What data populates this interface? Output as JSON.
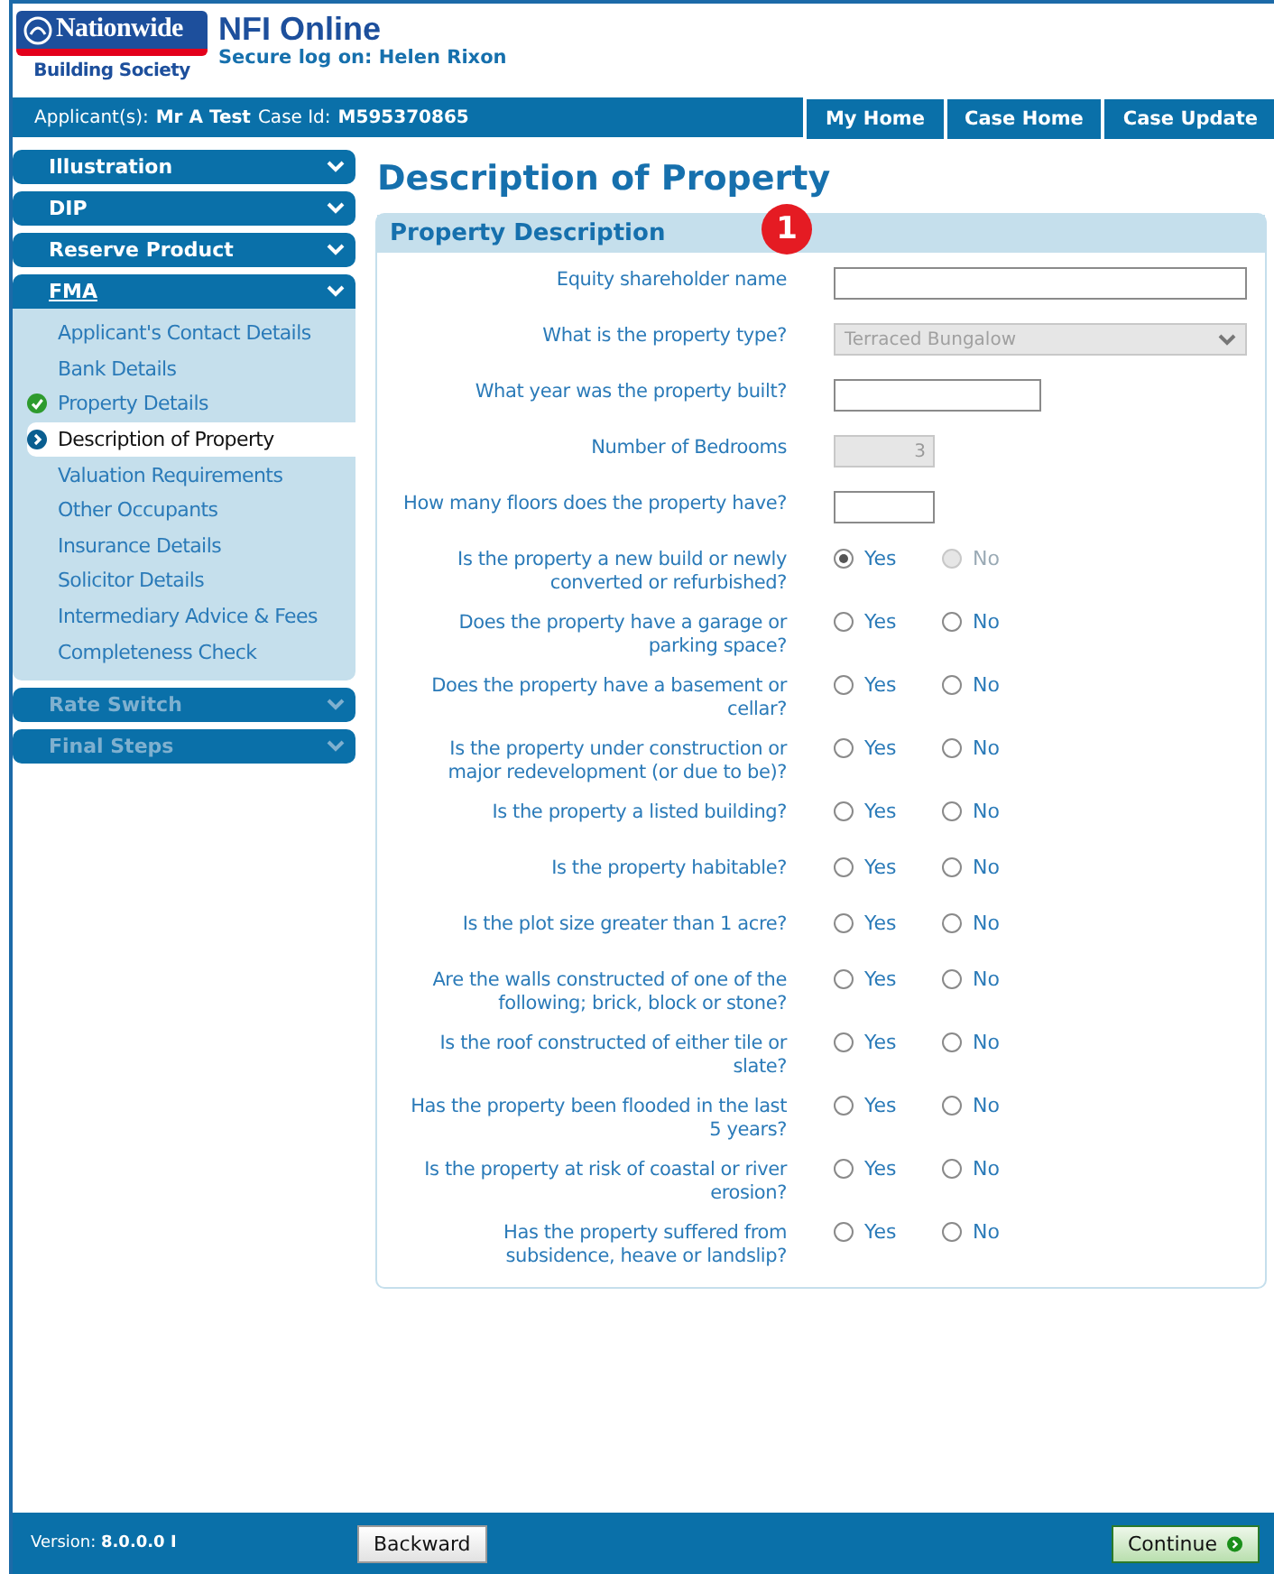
{
  "header": {
    "logo_name": "Nationwide",
    "logo_subtitle": "Building Society",
    "app_title": "NFI Online",
    "logon": "Secure log on: Helen Rixon"
  },
  "applicant_bar": {
    "applicant_label": "Applicant(s):",
    "applicant": "Mr A Test",
    "case_label": "Case Id:",
    "case_id": "M595370865"
  },
  "top_nav": [
    {
      "label": "My Home"
    },
    {
      "label": "Case Home"
    },
    {
      "label": "Case Update"
    }
  ],
  "sidebar": {
    "sections": [
      {
        "label": "Illustration",
        "selected": false,
        "disabled": false,
        "expanded": false
      },
      {
        "label": "DIP",
        "selected": false,
        "disabled": false,
        "expanded": false
      },
      {
        "label": "Reserve Product",
        "selected": false,
        "disabled": false,
        "expanded": false
      },
      {
        "label": "FMA",
        "selected": true,
        "disabled": false,
        "expanded": true,
        "children": [
          {
            "label": "Applicant's Contact Details",
            "selected": false,
            "completed": false
          },
          {
            "label": "Bank Details",
            "selected": false,
            "completed": false
          },
          {
            "label": "Property Details",
            "selected": false,
            "completed": true
          },
          {
            "label": "Description of Property",
            "selected": true,
            "completed": false
          },
          {
            "label": "Valuation Requirements",
            "selected": false,
            "completed": false
          },
          {
            "label": "Other Occupants",
            "selected": false,
            "completed": false
          },
          {
            "label": "Insurance Details",
            "selected": false,
            "completed": false
          },
          {
            "label": "Solicitor Details",
            "selected": false,
            "completed": false
          },
          {
            "label": "Intermediary Advice & Fees",
            "selected": false,
            "completed": false
          },
          {
            "label": "Completeness Check",
            "selected": false,
            "completed": false
          }
        ]
      },
      {
        "label": "Rate Switch",
        "selected": false,
        "disabled": true,
        "expanded": false
      },
      {
        "label": "Final Steps",
        "selected": false,
        "disabled": true,
        "expanded": false
      }
    ]
  },
  "page_title": "Description of Property",
  "panel": {
    "title": "Property Description",
    "badge": "1",
    "fields": [
      {
        "kind": "longtext",
        "label": "Equity shareholder name"
      },
      {
        "kind": "select",
        "label": "What is the property type?",
        "value": "Terraced Bungalow",
        "disabled": true
      },
      {
        "kind": "text",
        "label": "What year was the property built?"
      },
      {
        "kind": "shorttext",
        "label": "Number of Bedrooms",
        "value": "3",
        "disabled": true
      },
      {
        "kind": "shorttext",
        "label": "How many floors does the property have?"
      },
      {
        "kind": "radio",
        "label": "Is the property a new build or newly converted or refurbished?",
        "options": [
          {
            "label": "Yes",
            "selected": true,
            "disabled": false
          },
          {
            "label": "No",
            "selected": false,
            "disabled": true
          }
        ]
      },
      {
        "kind": "radio",
        "label": "Does the property have a garage or parking space?",
        "options": [
          {
            "label": "Yes",
            "selected": false,
            "disabled": false
          },
          {
            "label": "No",
            "selected": false,
            "disabled": false
          }
        ]
      },
      {
        "kind": "radio",
        "label": "Does the property have a basement or cellar?",
        "options": [
          {
            "label": "Yes",
            "selected": false,
            "disabled": false
          },
          {
            "label": "No",
            "selected": false,
            "disabled": false
          }
        ]
      },
      {
        "kind": "radio",
        "label": "Is the property under construction or major redevelopment (or due to be)?",
        "options": [
          {
            "label": "Yes",
            "selected": false,
            "disabled": false
          },
          {
            "label": "No",
            "selected": false,
            "disabled": false
          }
        ]
      },
      {
        "kind": "radio",
        "label": "Is the property a listed building?",
        "options": [
          {
            "label": "Yes",
            "selected": false,
            "disabled": false
          },
          {
            "label": "No",
            "selected": false,
            "disabled": false
          }
        ]
      },
      {
        "kind": "radio",
        "label": "Is the property habitable?",
        "options": [
          {
            "label": "Yes",
            "selected": false,
            "disabled": false
          },
          {
            "label": "No",
            "selected": false,
            "disabled": false
          }
        ]
      },
      {
        "kind": "radio",
        "label": "Is the plot size greater than 1 acre?",
        "options": [
          {
            "label": "Yes",
            "selected": false,
            "disabled": false
          },
          {
            "label": "No",
            "selected": false,
            "disabled": false
          }
        ]
      },
      {
        "kind": "radio",
        "label": "Are the walls constructed of one of the following; brick, block or stone?",
        "options": [
          {
            "label": "Yes",
            "selected": false,
            "disabled": false
          },
          {
            "label": "No",
            "selected": false,
            "disabled": false
          }
        ]
      },
      {
        "kind": "radio",
        "label": "Is the roof constructed of either tile or slate?",
        "options": [
          {
            "label": "Yes",
            "selected": false,
            "disabled": false
          },
          {
            "label": "No",
            "selected": false,
            "disabled": false
          }
        ]
      },
      {
        "kind": "radio",
        "label": "Has the property been flooded in the last 5 years?",
        "options": [
          {
            "label": "Yes",
            "selected": false,
            "disabled": false
          },
          {
            "label": "No",
            "selected": false,
            "disabled": false
          }
        ]
      },
      {
        "kind": "radio",
        "label": "Is the property at risk of coastal or river erosion?",
        "options": [
          {
            "label": "Yes",
            "selected": false,
            "disabled": false
          },
          {
            "label": "No",
            "selected": false,
            "disabled": false
          }
        ]
      },
      {
        "kind": "radio",
        "label": "Has the property suffered from subsidence, heave or landslip?",
        "options": [
          {
            "label": "Yes",
            "selected": false,
            "disabled": false
          },
          {
            "label": "No",
            "selected": false,
            "disabled": false
          }
        ]
      }
    ]
  },
  "footer": {
    "version_label": "Version:",
    "version": "8.0.0.0 I",
    "buttons": [
      {
        "label": "Backward",
        "kind": "back"
      },
      {
        "label": "Continue",
        "kind": "next"
      }
    ]
  }
}
